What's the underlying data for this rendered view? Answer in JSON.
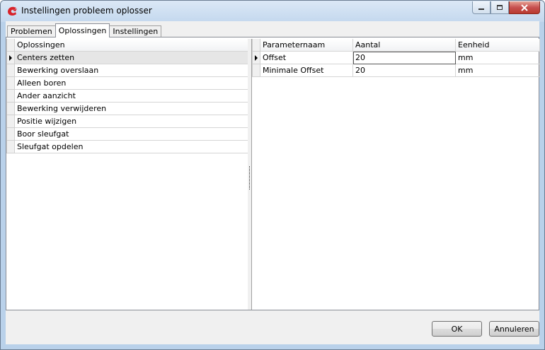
{
  "window": {
    "title": "Instellingen probleem oplosser",
    "controls": [
      "minimize",
      "maximize",
      "close"
    ]
  },
  "tabs": [
    {
      "label": "Problemen",
      "active": false
    },
    {
      "label": "Oplossingen",
      "active": true
    },
    {
      "label": "Instellingen",
      "active": false
    }
  ],
  "solutions_grid": {
    "header": "Oplossingen",
    "selected_index": 0,
    "rows": [
      "Centers zetten",
      "Bewerking overslaan",
      "Alleen boren",
      "Ander aanzicht",
      "Bewerking verwijderen",
      "Positie wijzigen",
      "Boor sleufgat",
      "Sleufgat opdelen"
    ]
  },
  "params_grid": {
    "headers": [
      "Parameternaam",
      "Aantal",
      "Eenheid"
    ],
    "selected_index": 0,
    "rows": [
      [
        "Offset",
        "20",
        "mm"
      ],
      [
        "Minimale Offset",
        "20",
        "mm"
      ]
    ]
  },
  "buttons": {
    "ok": "OK",
    "cancel": "Annuleren"
  },
  "colors": {
    "title_bar": "#c4d8ee",
    "close_button": "#c75050",
    "app_icon": "#d8222a",
    "selected_row": "#e6e6e6"
  }
}
